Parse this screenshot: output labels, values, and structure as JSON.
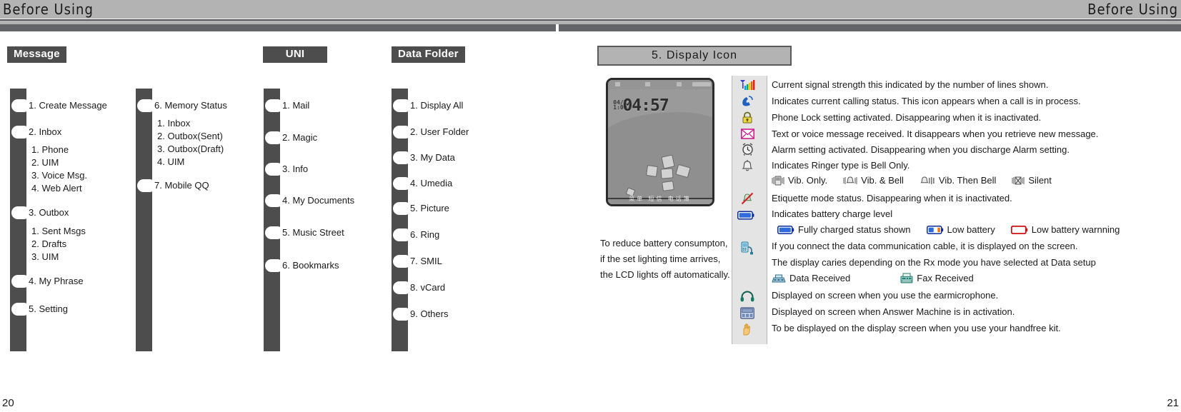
{
  "header": {
    "left_title": "Before Using",
    "right_title": "Before Using"
  },
  "page_numbers": {
    "left": "20",
    "right": "21"
  },
  "left_page": {
    "chips": [
      {
        "name": "message",
        "label": "Message"
      },
      {
        "name": "uni",
        "label": "UNI"
      },
      {
        "name": "data-folder",
        "label": "Data Folder"
      }
    ],
    "message_col_1": [
      {
        "label": "1. Create Message",
        "subs": []
      },
      {
        "label": "2. Inbox",
        "subs": [
          "1. Phone",
          "2. UIM",
          "3. Voice Msg.",
          "4. Web Alert"
        ]
      },
      {
        "label": "3. Outbox",
        "subs": [
          "1. Sent Msgs",
          "2. Drafts",
          "3. UIM"
        ]
      },
      {
        "label": "4. My Phrase",
        "subs": []
      },
      {
        "label": "5. Setting",
        "subs": []
      }
    ],
    "message_col_2": [
      {
        "label": "6. Memory Status",
        "subs": [
          "1. Inbox",
          "2. Outbox(Sent)",
          "3. Outbox(Draft)",
          "4. UIM"
        ]
      },
      {
        "label": "7. Mobile QQ",
        "subs": []
      }
    ],
    "uni_col": [
      {
        "label": "1. Mail"
      },
      {
        "label": "2. Magic"
      },
      {
        "label": "3. Info"
      },
      {
        "label": "4. My Documents"
      },
      {
        "label": "5. Music Street"
      },
      {
        "label": "6. Bookmarks"
      }
    ],
    "data_folder_col": [
      {
        "label": "1. Display All"
      },
      {
        "label": "2. User Folder"
      },
      {
        "label": "3. My Data"
      },
      {
        "label": "4. Umedia"
      },
      {
        "label": "5. Picture"
      },
      {
        "label": "6. Ring"
      },
      {
        "label": "7. SMIL"
      },
      {
        "label": "8. vCard"
      },
      {
        "label": "9. Others"
      }
    ]
  },
  "right_page": {
    "section_title": "5. Dispaly Icon",
    "phone": {
      "time": "04:57",
      "date_line1": "04/27",
      "date_line2": "1:00",
      "softkeys": "菜单    短信    电话簿"
    },
    "caption": [
      "To reduce battery consumpton,",
      "if the set lighting time arrives,",
      "the LCD lights off automatically."
    ],
    "icon_rows": [
      {
        "icon": "signal-bars-icon",
        "text": "Current signal strength this indicated by the number of lines shown."
      },
      {
        "icon": "handset-call-icon",
        "text": "Indicates current calling status. This icon appears when a call is in process."
      },
      {
        "icon": "padlock-icon",
        "text": "Phone Lock setting activated. Disappearing when it is inactivated."
      },
      {
        "icon": "envelope-icon",
        "text": "Text or voice message received. It disappears when you retrieve new message."
      },
      {
        "icon": "alarm-clock-icon",
        "text": "Alarm setting activated. Disappearing when you discharge Alarm setting."
      },
      {
        "icon": "bell-icon",
        "text": "Indicates Ringer type is Bell Only."
      },
      {
        "icon": "etiquette-mute-icon",
        "text": "Etiquette mode status. Disappearing when it is inactivated."
      },
      {
        "icon": "battery-icon",
        "text": "Indicates battery charge level"
      },
      {
        "icon": "data-cable-icon",
        "text": "If you connect the data communication cable, it is displayed on the screen."
      },
      {
        "icon": "headset-icon",
        "text": "Displayed on screen when you use the earmicrophone."
      },
      {
        "icon": "answer-machine-icon",
        "text": "Displayed on screen when Answer Machine is in activation."
      },
      {
        "icon": "hand-icon",
        "text": "To be displayed on the display screen when you use your handfree kit."
      }
    ],
    "ringer_modes": [
      {
        "icon": "vib-only-icon",
        "label": "Vib. Only."
      },
      {
        "icon": "vib-and-bell-icon",
        "label": "Vib. & Bell"
      },
      {
        "icon": "vib-then-bell-icon",
        "label": "Vib. Then Bell"
      },
      {
        "icon": "silent-icon",
        "label": "Silent"
      }
    ],
    "battery_states": [
      {
        "icon": "battery-full-icon",
        "label": "Fully charged status shown"
      },
      {
        "icon": "battery-low-icon",
        "label": "Low battery"
      },
      {
        "icon": "battery-warning-icon",
        "label": "Low battery warnning"
      }
    ],
    "rx_mode_note": "The display caries depending on the Rx mode you have selected at Data setup",
    "rx_modes": [
      {
        "icon": "data-received-icon",
        "label": "Data Received"
      },
      {
        "icon": "fax-received-icon",
        "label": "Fax Received"
      }
    ]
  },
  "colors": {
    "header_band": "#b3b3b3",
    "rule_thick": "#646569",
    "rail_dark": "#4d4d4d",
    "chip_bg": "#4d4d4d",
    "icon_rail_bg": "#e4e4e4"
  }
}
